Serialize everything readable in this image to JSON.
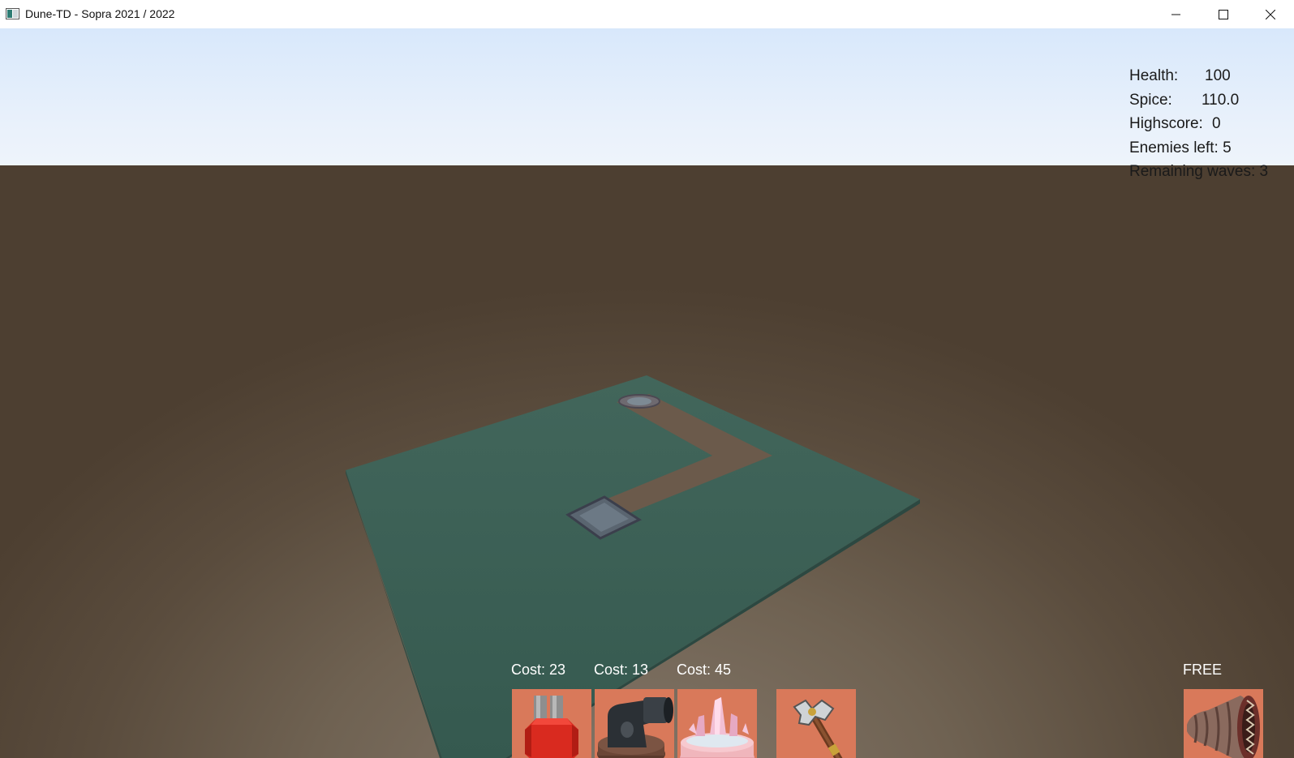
{
  "window": {
    "title": "Dune-TD - Sopra 2021 / 2022",
    "controls": [
      "minimize-icon",
      "maximize-icon",
      "close-icon"
    ]
  },
  "hud": {
    "health_label": "Health:",
    "health_value": "100",
    "spice_label": "Spice:",
    "spice_value": "110.0",
    "highscore_label": "Highscore:",
    "highscore_value": "0",
    "enemies_label": "Enemies left: 5",
    "waves_label": "Remaining waves: 3"
  },
  "shop": {
    "items": [
      {
        "name": "Rocket Tower",
        "icon": "rocket-tower-icon",
        "cost_label": "Cost: 23"
      },
      {
        "name": "Cannon Tower",
        "icon": "cannon-tower-icon",
        "cost_label": "Cost: 13"
      },
      {
        "name": "Crystal Tower",
        "icon": "crystal-tower-icon",
        "cost_label": "Cost: 45"
      },
      {
        "name": "Hammer",
        "icon": "hammer-icon",
        "cost_label": ""
      }
    ],
    "special": {
      "name": "Sandworm",
      "icon": "sandworm-icon",
      "cost_label": "FREE"
    }
  },
  "colors": {
    "sky": "#e4eefb",
    "ground": "#5a4c3d",
    "board": "#3f6358",
    "path": "#6b5a4b",
    "slot": "#d9795a"
  }
}
